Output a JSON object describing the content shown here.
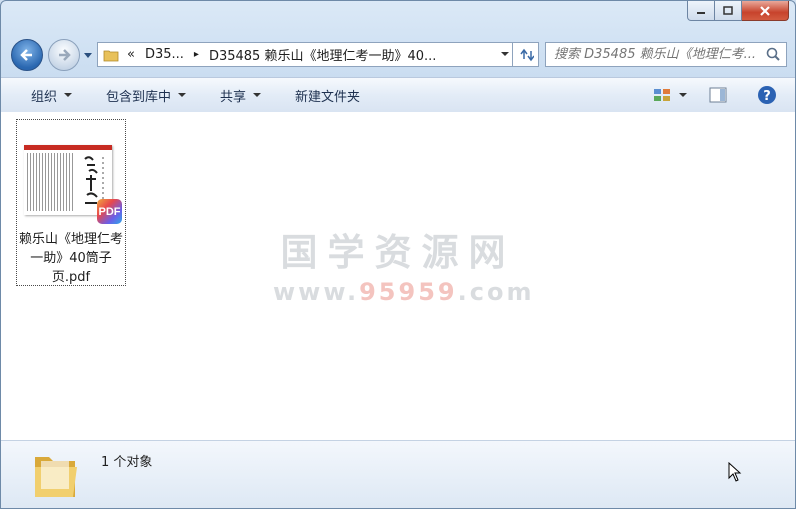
{
  "window": {
    "controls": {
      "minimize": "minimize",
      "maximize": "maximize",
      "close": "close"
    }
  },
  "nav": {
    "breadcrumb": [
      {
        "label": "«"
      },
      {
        "label": "D35..."
      },
      {
        "label": "▸"
      },
      {
        "label": "D35485 赖乐山《地理仁考一助》40..."
      }
    ],
    "search_placeholder": "搜索 D35485 赖乐山《地理仁考...",
    "icons": {
      "back": "back-arrow-icon",
      "forward": "forward-arrow-icon",
      "refresh": "refresh-icon",
      "search": "search-icon"
    }
  },
  "toolbar": {
    "organize": "组织",
    "include_in_library": "包含到库中",
    "share": "共享",
    "new_folder": "新建文件夹"
  },
  "content": {
    "files": [
      {
        "name": "赖乐山《地理仁考一助》40筒子页.pdf",
        "type_badge": "PDF"
      }
    ],
    "watermark": {
      "line1": "国学资源网",
      "line2_prefix": "www.",
      "line2_number": "95959",
      "line2_suffix": ".com"
    }
  },
  "details": {
    "count": "1 个对象"
  },
  "colors": {
    "close_button": "#c7432c",
    "accent": "#2a67b0",
    "watermark": "#d9dcdf"
  }
}
